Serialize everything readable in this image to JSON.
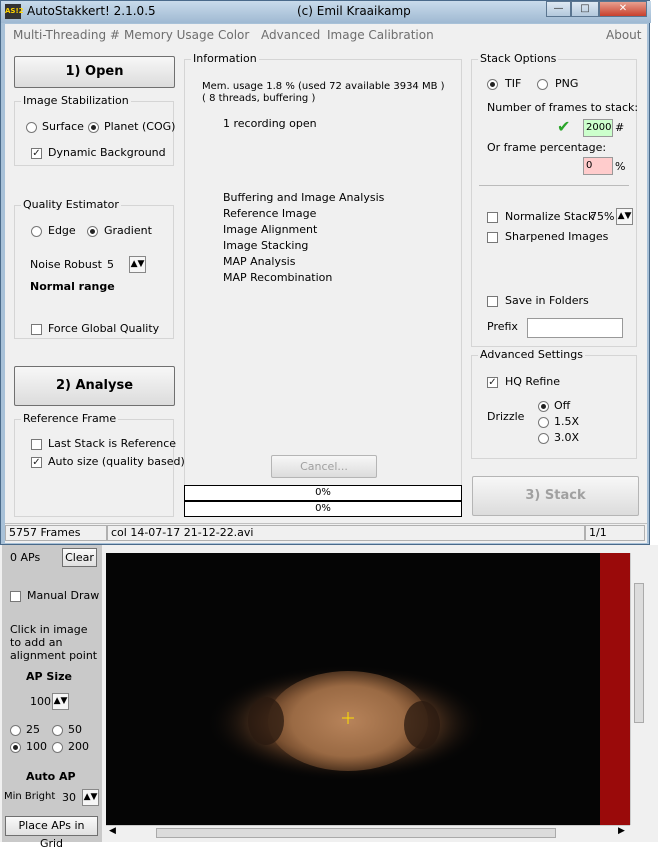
{
  "window": {
    "title": "AutoStakkert! 2.1.0.5",
    "author": "(c) Emil Kraaikamp",
    "app_icon_text": "AS!2"
  },
  "menu": [
    "Multi-Threading #",
    "Memory Usage",
    "Color",
    "Advanced",
    "Image Calibration",
    "About"
  ],
  "buttons": {
    "open": "1) Open",
    "analyse": "2) Analyse",
    "stack": "3) Stack",
    "cancel": "Cancel..."
  },
  "image_stabilization": {
    "label": "Image Stabilization",
    "options": [
      "Surface",
      "Planet (COG)"
    ],
    "selected": "Planet (COG)",
    "dynamic_background": {
      "label": "Dynamic Background",
      "checked": true
    }
  },
  "quality_estimator": {
    "label": "Quality Estimator",
    "options": [
      "Edge",
      "Gradient"
    ],
    "selected": "Gradient",
    "noise_robust_label": "Noise Robust",
    "noise_robust_value": "5",
    "range_text": "Normal range",
    "force_global": {
      "label": "Force Global Quality",
      "checked": false
    }
  },
  "reference_frame": {
    "label": "Reference Frame",
    "last_stack": {
      "label": "Last Stack is Reference",
      "checked": false
    },
    "auto_size": {
      "label": "Auto size (quality based)",
      "checked": true
    }
  },
  "information": {
    "label": "Information",
    "mem_line1": "Mem. usage 1.8 %  (used 72 available 3934 MB )",
    "mem_line2": "( 8 threads, buffering )",
    "recording": "1 recording open",
    "steps": [
      "Buffering and Image Analysis",
      "Reference Image",
      "Image Alignment",
      "Image Stacking",
      "MAP Analysis",
      "MAP Recombination"
    ],
    "progress1": "0%",
    "progress2": "0%"
  },
  "stack_options": {
    "label": "Stack Options",
    "formats": [
      "TIF",
      "PNG"
    ],
    "selected_format": "TIF",
    "frames_label": "Number of frames to stack:",
    "frames_value": "2000",
    "frames_suffix": "#",
    "percentage_label": "Or frame percentage:",
    "percentage_value": "0",
    "percentage_suffix": "%",
    "normalize": {
      "label": "Normalize Stack",
      "checked": false,
      "value": "75%"
    },
    "sharpened": {
      "label": "Sharpened Images",
      "checked": false
    },
    "save_in_folders": {
      "label": "Save in Folders",
      "checked": false
    },
    "prefix_label": "Prefix",
    "prefix_value": "",
    "field_green": "#ccffcc",
    "field_pink": "#ffcccc"
  },
  "advanced_settings": {
    "label": "Advanced Settings",
    "hq_refine": {
      "label": "HQ Refine",
      "checked": true
    },
    "drizzle_label": "Drizzle",
    "drizzle_options": [
      "Off",
      "1.5X",
      "3.0X"
    ],
    "drizzle_selected": "Off"
  },
  "status": {
    "frames": "5757 Frames",
    "file": "col 14-07-17 21-12-22.avi",
    "page": "1/1"
  },
  "ap_panel": {
    "aps_count": "0 APs",
    "clear": "Clear",
    "manual_draw": {
      "label": "Manual Draw",
      "checked": false
    },
    "hint": [
      "Click in image",
      "to add an",
      "alignment point"
    ],
    "ap_size_label": "AP Size",
    "ap_size_value": "100",
    "sizes": [
      "25",
      "50",
      "100",
      "200"
    ],
    "size_selected": "100",
    "auto_ap_label": "Auto AP",
    "min_bright_label": "Min Bright",
    "min_bright_value": "30",
    "place_grid": "Place APs in Grid"
  },
  "colors": {
    "title_bar": "#b4cbe0",
    "client_bg": "#f0f0f0",
    "dark_red": "#9a0a0a",
    "crosshair": "#ffe000"
  }
}
